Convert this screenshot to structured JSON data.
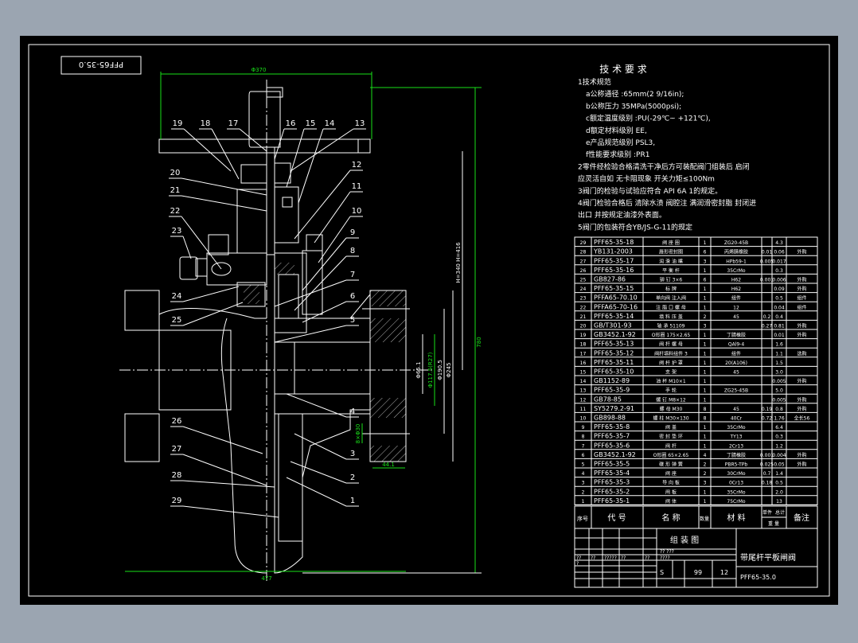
{
  "drawing": {
    "code_tag": "PFF65-35.0",
    "dimensions": {
      "handwheel_dia": "Φ370",
      "overall_height": "780",
      "stroke": "H=340  H=416",
      "bore": "Φ65.1",
      "seal_dia": "Φ117.5(R27)",
      "bolt_circle": "Φ190.5",
      "flange_dia": "Φ245",
      "bolt_holes": "8×Φ30",
      "flange_thk": "44.1",
      "face_to_face": "477"
    },
    "balloons_left": [
      "19",
      "18",
      "17",
      "20",
      "21",
      "22",
      "23",
      "24",
      "25",
      "26",
      "27",
      "28",
      "29"
    ],
    "balloons_right": [
      "16",
      "15",
      "14",
      "13",
      "12",
      "11",
      "10",
      "9",
      "8",
      "7",
      "6",
      "5",
      "4",
      "3",
      "2",
      "1"
    ]
  },
  "requirements": {
    "title": "技 术 要 求",
    "lines": [
      "1技术规范",
      "a公称通径 :65mm(2 9/16in);",
      "b公称压力 35MPa(5000psi);",
      "c额定温度级别 :PU(-29℃~ +121℃),",
      "d额定材料级别 EE,",
      "e产品规范级别 PSL3,",
      "f性能要求级别 :PR1",
      "2零件经检验合格清洗干净后方可装配阀门组装后 启闭",
      " 应灵活自如 无卡阻现象 开关力矩≤100Nm",
      "3阀门的检验与试验应符合 API 6A 1的规定。",
      "4阀门检验合格后 清除水渍 阀腔注 满润滑密封脂 封闭进",
      " 出口 并按规定油漆外表面。",
      "5阀门的包装符合YB/JS-G-11的规定"
    ]
  },
  "parts_list": {
    "rows": [
      [
        "29",
        "PFF65-35-18",
        "阀 座 圈",
        "1",
        "ZG20-45B",
        "",
        "4.3",
        ""
      ],
      [
        "28",
        "YB131-2003",
        "唇形密封圈",
        "6",
        "丙烯腈橡胶",
        "0.01",
        "0.06",
        "外购"
      ],
      [
        "27",
        "PFF65-35-17",
        "润 滑 油 嘴",
        "3",
        "HPb59-1",
        "0.005",
        "0.017",
        ""
      ],
      [
        "26",
        "PFF65-35-16",
        "平 衡 杆",
        "1",
        "35CrMo",
        "",
        "0.3",
        ""
      ],
      [
        "25",
        "GB827-86",
        "铆 钉 3×6",
        "6",
        "H62",
        "0.001",
        "0.006",
        "外购"
      ],
      [
        "24",
        "PFF65-35-15",
        "标 牌",
        "1",
        "H62",
        "",
        "0.09",
        "外购"
      ],
      [
        "23",
        "PFFA65-70.10",
        "单向阀 注入阀",
        "1",
        "组件",
        "",
        "0.5",
        "组件"
      ],
      [
        "22",
        "PFFA65-70-16",
        "注 脂 口 螺 母",
        "1",
        "12",
        "",
        "0.04",
        "组件"
      ],
      [
        "21",
        "PFF65-35-14",
        "填 料 压 盖",
        "2",
        "45",
        "0.2",
        "0.4",
        ""
      ],
      [
        "20",
        "GB/T301-93",
        "轴 承 51109",
        "3",
        "",
        "0.27",
        "0.81",
        "外购"
      ],
      [
        "19",
        "GB3452.1-92",
        "O形圈 175×2.65",
        "1",
        "丁腈橡胶",
        "",
        "0.01",
        "外购"
      ],
      [
        "18",
        "PFF65-35-13",
        "阀 杆 螺 母",
        "1",
        "QAl9-4",
        "",
        "1.6",
        ""
      ],
      [
        "17",
        "PFF65-35-12",
        "阀杆填料组件 3",
        "1",
        "组件",
        "",
        "1.1",
        "选购"
      ],
      [
        "16",
        "PFF65-35-11",
        "阀 杆 护 罩",
        "1",
        "20(A106)",
        "",
        "1.5",
        ""
      ],
      [
        "15",
        "PFF65-35-10",
        "支 架",
        "1",
        "45",
        "",
        "3.0",
        ""
      ],
      [
        "14",
        "GB1152-89",
        "油 杯 M10×1",
        "1",
        "",
        "",
        "0.005",
        "外购"
      ],
      [
        "13",
        "PFF65-35-9",
        "手 轮",
        "1",
        "ZG25-45B",
        "",
        "5.0",
        ""
      ],
      [
        "12",
        "GB78-85",
        "螺 钉 M8×12",
        "1",
        "",
        "",
        "0.005",
        "外购"
      ],
      [
        "11",
        "SY5279.2-91",
        "螺 母 M30",
        "8",
        "45",
        "0.19",
        "0.8",
        "外购"
      ],
      [
        "10",
        "GB898-88",
        "螺 柱 M30×130",
        "8",
        "40Cr",
        "0.72",
        "1.76",
        "全长56"
      ],
      [
        "9",
        "PFF65-35-8",
        "阀 盖",
        "1",
        "35CrMo",
        "",
        "6.4",
        ""
      ],
      [
        "8",
        "PFF65-35-7",
        "密 封 垫 环",
        "1",
        "TY13",
        "",
        "0.3",
        ""
      ],
      [
        "7",
        "PFF65-35-6",
        "阀 杆",
        "1",
        "2Cr13",
        "",
        "1.2",
        ""
      ],
      [
        "6",
        "GB3452.1-92",
        "O形圈 65×2.65",
        "4",
        "丁腈橡胶",
        "0.001",
        "0.004",
        "外购"
      ],
      [
        "5",
        "PFF65-35-5",
        "碟 形 弹 簧",
        "2",
        "PBR5-TPb",
        "0.025",
        "0.05",
        "外购"
      ],
      [
        "4",
        "PFF65-35-4",
        "阀 座",
        "2",
        "30CrMo",
        "0.7",
        "1.4",
        ""
      ],
      [
        "3",
        "PFF65-35-3",
        "导 向 板",
        "3",
        "0Cr13",
        "0.18",
        "0.5",
        ""
      ],
      [
        "2",
        "PFF65-35-2",
        "闸 板",
        "1",
        "35CrMo",
        "",
        "2.0",
        ""
      ],
      [
        "1",
        "PFF65-35-1",
        "阀 体",
        "1",
        "75CrMo",
        "",
        "13",
        ""
      ]
    ],
    "header": {
      "seq": "序号",
      "code": "代 号",
      "name": "名 称",
      "qty": "数量",
      "material": "材 料",
      "unit_weight": "单件",
      "total_weight": "总计",
      "weight": "重 量",
      "note": "备注"
    }
  },
  "title_block": {
    "drawing_type": "组 装 图",
    "product_name": "带尾杆平板闸阀",
    "drawing_no": "PFF65-35.0",
    "stage": "S",
    "scale": "99",
    "sheets": "12",
    "placeholder_row_a": [
      "??",
      "??",
      "?????",
      "??",
      "??"
    ],
    "placeholder_small": "?",
    "placeholder_mid": "?? ???",
    "placeholder_mid2": "????"
  },
  "colors": {
    "background": "#000000",
    "frame": "#9ba5b1",
    "line": "#ffffff",
    "dimension": "#19e019"
  }
}
